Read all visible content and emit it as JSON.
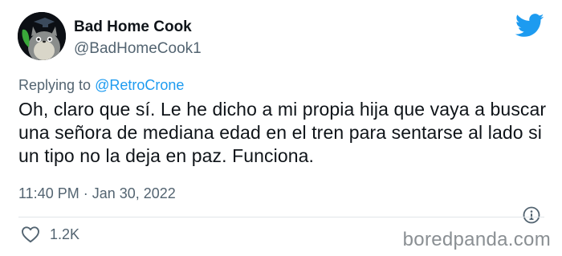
{
  "tweet": {
    "display_name": "Bad Home Cook",
    "handle": "@BadHomeCook1",
    "replying_to_prefix": "Replying to ",
    "replying_to_handle": "@RetroCrone",
    "text": "Oh, claro que sí. Le he dicho a mi propia hija que vaya a buscar una señora de mediana edad en el tren para sentarse al lado si un tipo no la deja en paz. Funciona.",
    "timestamp": "11:40 PM · Jan 30, 2022",
    "like_count": "1.2K"
  },
  "icons": {
    "brand": "twitter-bird-icon",
    "info": "info-icon",
    "like": "heart-outline-icon"
  },
  "watermark": "boredpanda.com",
  "colors": {
    "text_primary": "#0f1419",
    "text_secondary": "#536471",
    "accent": "#1d9bf0",
    "watermark": "#8a8f93"
  }
}
